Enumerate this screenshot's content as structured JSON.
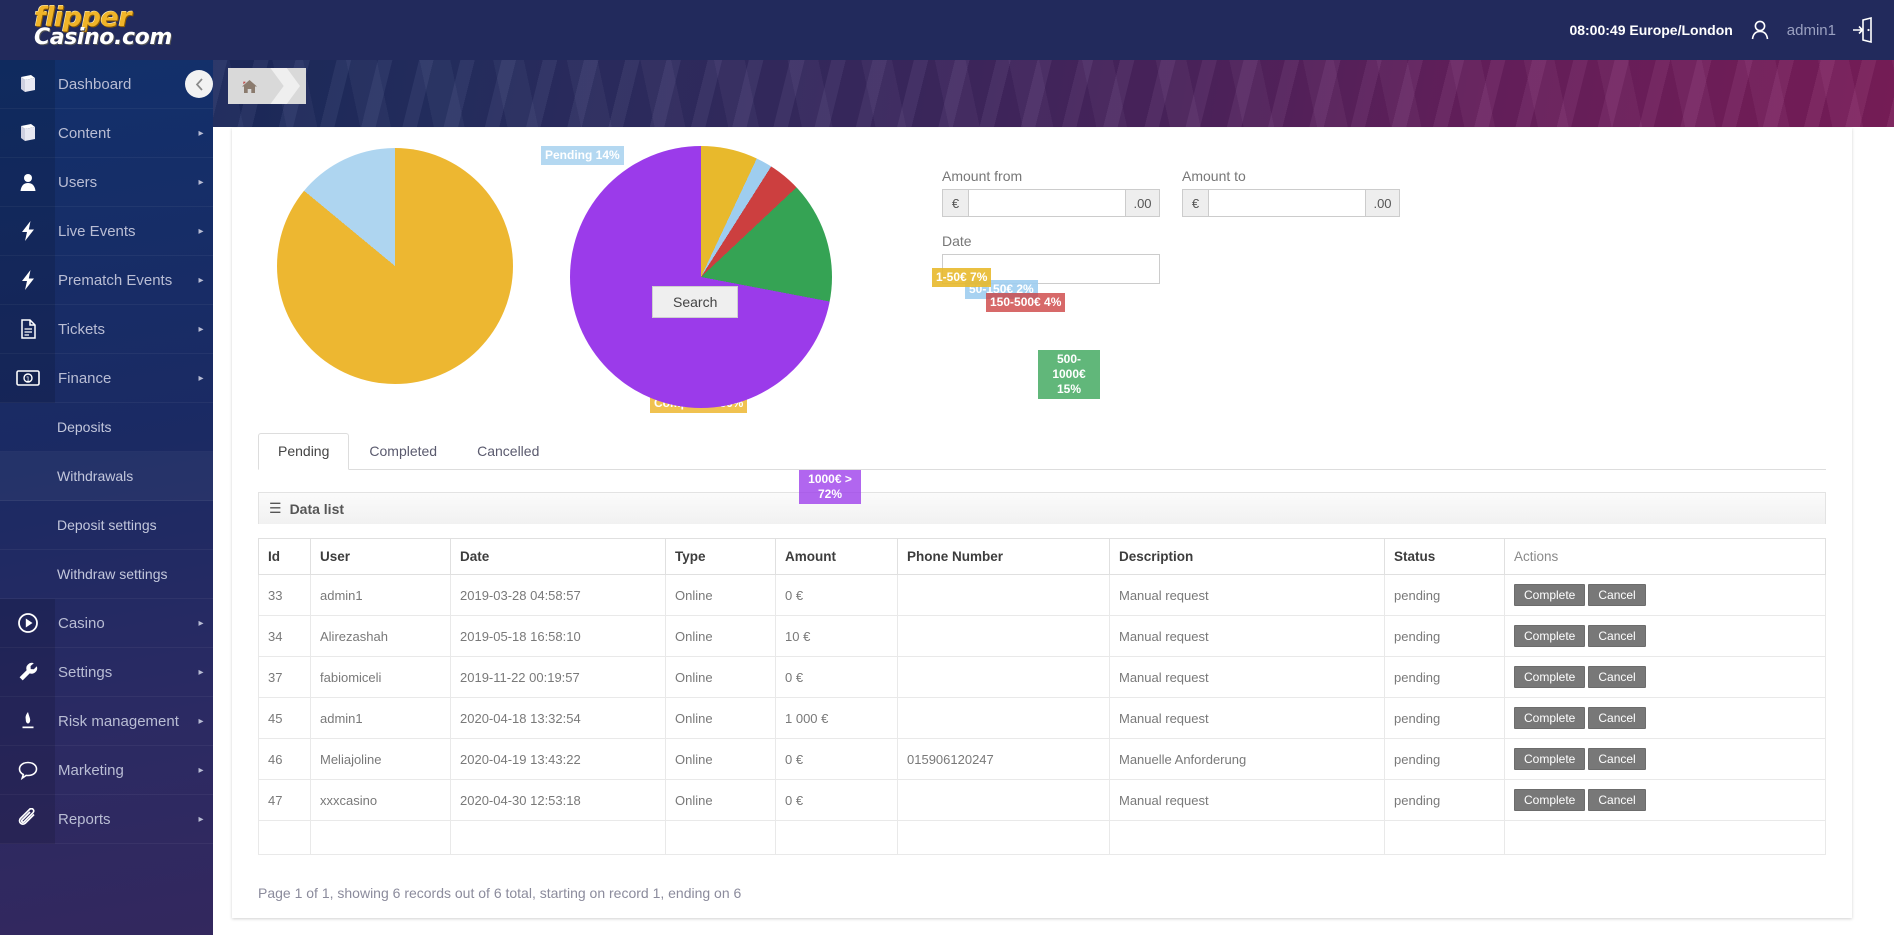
{
  "brand": {
    "logo_top": "flipper",
    "logo_bottom": "Casino.com"
  },
  "header": {
    "clock": "08:00:49 Europe/London",
    "user": "admin1",
    "avatar_icon": "user-avatar-icon",
    "logout_icon": "logout-icon"
  },
  "breadcrumb": {
    "home_icon": "home-icon",
    "chevron_icon": "chevron-right-icon"
  },
  "collapse_icon": "chevron-left-icon",
  "sidebar": {
    "items": [
      {
        "label": "Dashboard",
        "icon": "book-icon",
        "arrow": "▸"
      },
      {
        "label": "Content",
        "icon": "book-icon",
        "arrow": "▸"
      },
      {
        "label": "Users",
        "icon": "user-icon",
        "arrow": "▸"
      },
      {
        "label": "Live Events",
        "icon": "bolt-icon",
        "arrow": "▸"
      },
      {
        "label": "Prematch Events",
        "icon": "bolt-icon",
        "arrow": "▸"
      },
      {
        "label": "Tickets",
        "icon": "document-icon",
        "arrow": "▸"
      },
      {
        "label": "Finance",
        "icon": "money-icon",
        "arrow": "▸"
      }
    ],
    "finance_sub": [
      {
        "label": "Deposits",
        "active": false
      },
      {
        "label": "Withdrawals",
        "active": true
      },
      {
        "label": "Deposit settings",
        "active": false
      },
      {
        "label": "Withdraw settings",
        "active": false
      }
    ],
    "items_after": [
      {
        "label": "Casino",
        "icon": "play-circle-icon",
        "arrow": "▸"
      },
      {
        "label": "Settings",
        "icon": "wrench-icon",
        "arrow": "▸"
      },
      {
        "label": "Risk management",
        "icon": "flame-icon",
        "arrow": "▸"
      },
      {
        "label": "Marketing",
        "icon": "chat-icon",
        "arrow": "▸"
      },
      {
        "label": "Reports",
        "icon": "paperclip-icon",
        "arrow": "▸"
      }
    ]
  },
  "chart_data": [
    {
      "type": "pie",
      "title": "",
      "legend_position": "labels-on-slices",
      "categories": [
        "Completed",
        "Pending"
      ],
      "values": [
        86,
        14
      ],
      "value_unit": "%",
      "colors": [
        "#edb731",
        "#aed5f0"
      ],
      "labels": [
        "Completed 86%",
        "Pending 14%"
      ]
    },
    {
      "type": "pie",
      "title": "",
      "legend_position": "labels-on-slices",
      "categories": [
        "1-50€",
        "50-150€",
        "150-500€",
        "500-1000€",
        "1000€ >"
      ],
      "values": [
        7,
        2,
        4,
        15,
        72
      ],
      "value_unit": "%",
      "colors": [
        "#e8b92c",
        "#9ecdef",
        "#cc3f3f",
        "#35a354",
        "#9b3bea"
      ],
      "labels": [
        "1-50€ 7%",
        "50-150€ 2%",
        "150-500€ 4%",
        "500-1000€ 15%",
        "1000€ > 72%"
      ]
    }
  ],
  "search": {
    "amount_from_label": "Amount from",
    "amount_to_label": "Amount to",
    "date_label": "Date",
    "currency_prefix": "€",
    "decimal_suffix": ".00",
    "amount_from_value": "",
    "amount_to_value": "",
    "date_value": "",
    "amount_from_placeholder": "",
    "amount_to_placeholder": "",
    "date_placeholder": "",
    "search_button": "Search"
  },
  "tabs": [
    {
      "label": "Pending",
      "active": true
    },
    {
      "label": "Completed",
      "active": false
    },
    {
      "label": "Cancelled",
      "active": false
    }
  ],
  "datalist": {
    "title": "Data list",
    "bars_icon": "hamburger-icon",
    "columns": [
      "Id",
      "User",
      "Date",
      "Type",
      "Amount",
      "Phone Number",
      "Description",
      "Status",
      "Actions"
    ],
    "rows": [
      {
        "id": "33",
        "user": "admin1",
        "date": "2019-03-28 04:58:57",
        "type": "Online",
        "amount": "0 €",
        "phone": "",
        "description": "Manual request",
        "status": "pending",
        "complete": "Complete",
        "cancel": "Cancel"
      },
      {
        "id": "34",
        "user": "Alirezashah",
        "date": "2019-05-18 16:58:10",
        "type": "Online",
        "amount": "10 €",
        "phone": "",
        "description": "Manual request",
        "status": "pending",
        "complete": "Complete",
        "cancel": "Cancel"
      },
      {
        "id": "37",
        "user": "fabiomiceli",
        "date": "2019-11-22 00:19:57",
        "type": "Online",
        "amount": "0 €",
        "phone": "",
        "description": "Manual request",
        "status": "pending",
        "complete": "Complete",
        "cancel": "Cancel"
      },
      {
        "id": "45",
        "user": "admin1",
        "date": "2020-04-18 13:32:54",
        "type": "Online",
        "amount": "1 000 €",
        "phone": "",
        "description": "Manual request",
        "status": "pending",
        "complete": "Complete",
        "cancel": "Cancel"
      },
      {
        "id": "46",
        "user": "Meliajoline",
        "date": "2020-04-19 13:43:22",
        "type": "Online",
        "amount": "0 €",
        "phone": "015906120247",
        "description": "Manuelle Anforderung",
        "status": "pending",
        "complete": "Complete",
        "cancel": "Cancel"
      },
      {
        "id": "47",
        "user": "xxxcasino",
        "date": "2020-04-30 12:53:18",
        "type": "Online",
        "amount": "0 €",
        "phone": "",
        "description": "Manual request",
        "status": "pending",
        "complete": "Complete",
        "cancel": "Cancel"
      }
    ],
    "pager": "Page 1 of 1, showing 6 records out of 6 total, starting on record 1, ending on 6"
  }
}
